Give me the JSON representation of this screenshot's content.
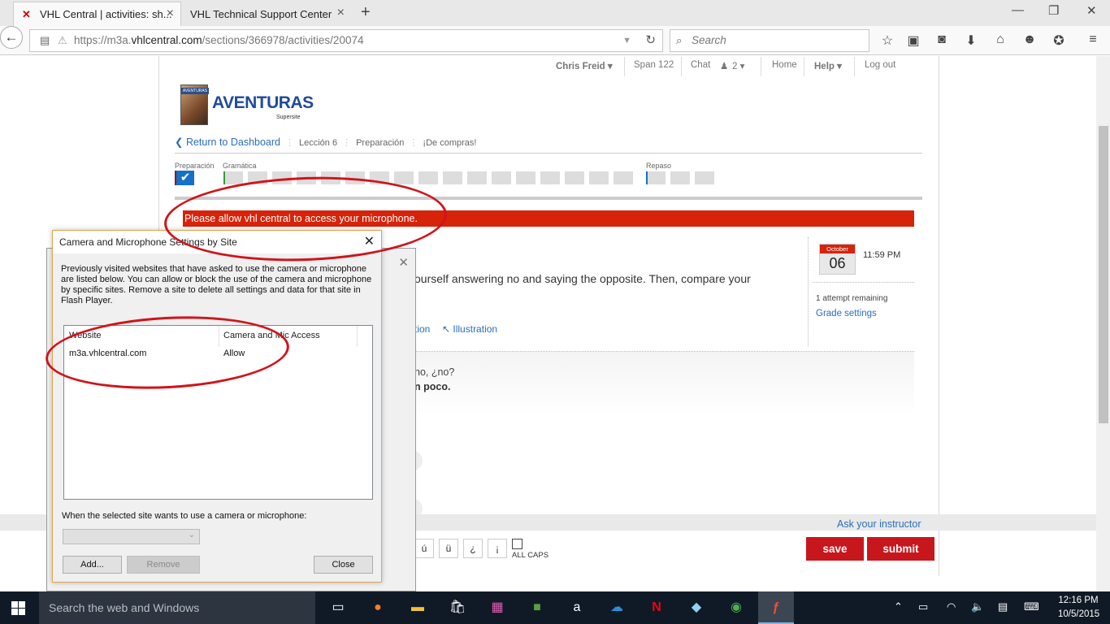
{
  "browser": {
    "tabs": [
      {
        "title": "VHL Central | activities: sh...",
        "active": true
      },
      {
        "title": "VHL Technical Support Center",
        "active": false
      }
    ],
    "url": {
      "prefix": "https://m3a.",
      "host": "vhlcentral.com",
      "path": "/sections/366978/activities/20074"
    },
    "search_placeholder": "Search"
  },
  "topnav": {
    "user": "Chris Freid ▾",
    "course": "Span 122",
    "chat": "Chat",
    "chat_count": "2 ▾",
    "home": "Home",
    "help": "Help ▾",
    "logout": "Log out"
  },
  "logo": {
    "title": "AVENTURAS",
    "subtitle": "Supersite",
    "book_band": "AVENTURAS"
  },
  "breadcrumb": {
    "return": "Return to Dashboard",
    "lesson": "Lección 6",
    "section": "Preparación",
    "activity": "¡De compras!"
  },
  "progress": {
    "label_prep": "Preparación",
    "label_gram": "Gramática",
    "label_repaso": "Repaso"
  },
  "mic_banner": "Please allow vhl central to access your microphone.",
  "activity": {
    "instructions": "ourself answering no and saying the opposite. Then, compare your",
    "link_left": "tion",
    "link_illustration": "↖ Illustration",
    "question_line1": "ho, ¿no?",
    "question_line2": "n poco."
  },
  "due": {
    "month": "October",
    "day": "06",
    "time": "11:59 PM",
    "attempts": "1 attempt remaining",
    "grade_settings": "Grade settings"
  },
  "footer": {
    "ask_instructor": "Ask your instructor",
    "chars": [
      "ú",
      "ü",
      "¿",
      "¡"
    ],
    "all_caps": "ALL CAPS",
    "save": "save",
    "submit": "submit"
  },
  "dialog": {
    "title": "Camera and Microphone Settings by Site",
    "description": "Previously visited websites that have asked to use the camera or microphone are listed below. You can allow or block the use of the camera and microphone by specific sites. Remove a site to delete all settings and data for that site in Flash Player.",
    "columns": [
      "Website",
      "Camera and Mic Access"
    ],
    "rows": [
      {
        "website": "m3a.vhlcentral.com",
        "access": "Allow"
      }
    ],
    "when_label": "When the selected site wants to use a camera or microphone:",
    "add": "Add...",
    "remove": "Remove",
    "close": "Close"
  },
  "taskbar": {
    "search_placeholder": "Search the web and Windows",
    "time": "12:16 PM",
    "date": "10/5/2015"
  },
  "colors": {
    "accent_red": "#d6230a",
    "link_blue": "#2a6ebb",
    "button_red": "#c8161d",
    "annotation": "#d0141b"
  }
}
